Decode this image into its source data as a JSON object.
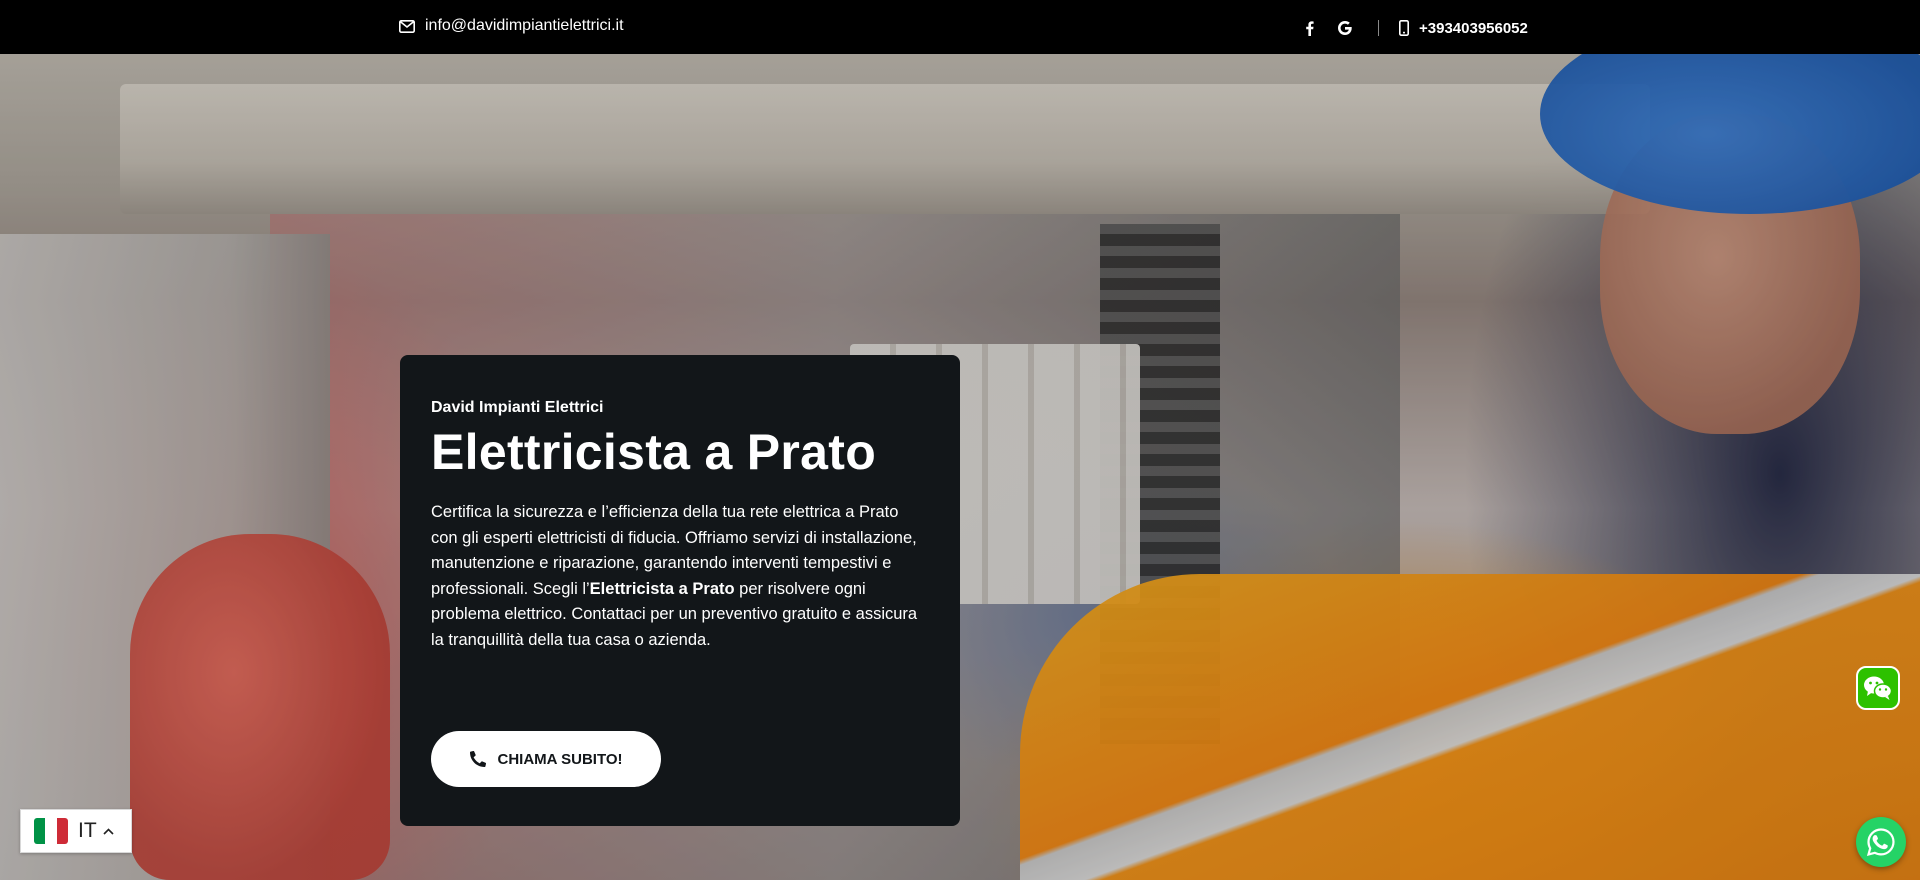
{
  "topbar": {
    "email": "info@davidimpiantielettrici.it",
    "email_icon": "envelope-icon",
    "social_icons": [
      "facebook-icon",
      "google-icon"
    ],
    "phone": "+393403956052",
    "phone_icon": "mobile-phone-icon"
  },
  "hero": {
    "eyebrow": "David Impianti Elettrici",
    "title": "Elettricista a Prato",
    "text_before": "Certifica la sicurezza e l’efficienza della tua rete elettrica a Prato con gli esperti elettricisti di fiducia. Offriamo servizi di installazione, manutenzione e riparazione, garantendo interventi tempestivi e professionali. Scegli l’",
    "text_bold": "Elettricista a Prato",
    "text_after": " per risolvere ogni problema elettrico. Contattaci per un preventivo gratuito e assicura la tranquillità della tua casa o azienda.",
    "cta_label": "CHIAMA SUBITO!",
    "cta_icon": "phone-icon"
  },
  "language": {
    "code": "IT",
    "flag_colors": [
      "#009246",
      "#ffffff",
      "#ce2b37"
    ]
  },
  "floating": {
    "wechat_icon": "wechat-icon",
    "whatsapp_icon": "whatsapp-icon"
  },
  "colors": {
    "card_bg": "#121619",
    "topbar_bg": "#000000",
    "wechat_green": "#2dc100",
    "whatsapp_green": "#25d366"
  }
}
